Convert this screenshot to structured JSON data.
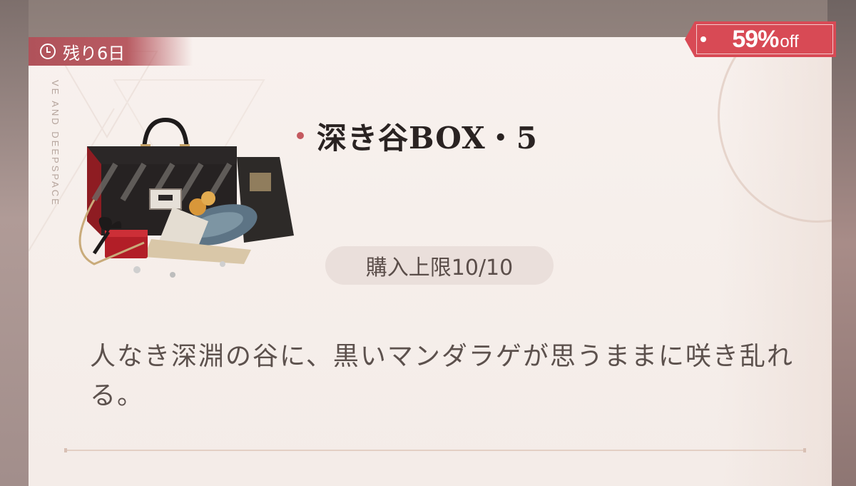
{
  "timer": {
    "label": "残り6日",
    "icon": "clock-icon"
  },
  "discount": {
    "percent": "59%",
    "suffix": "off",
    "color": "#d84a55"
  },
  "decor": {
    "vertical_text": "VE AND DEEPSPACE"
  },
  "product": {
    "title": "深き谷BOX・5",
    "image_icon": "gift-box-bundle-image",
    "purchase_limit": "購入上限10/10",
    "description": "人なき深淵の谷に、黒いマンダラゲが思うままに咲き乱れる。"
  },
  "colors": {
    "accent_red": "#b0525a",
    "title_text": "#2a2322",
    "body_text": "#5c514d",
    "card_bg": "#f6efeb"
  }
}
